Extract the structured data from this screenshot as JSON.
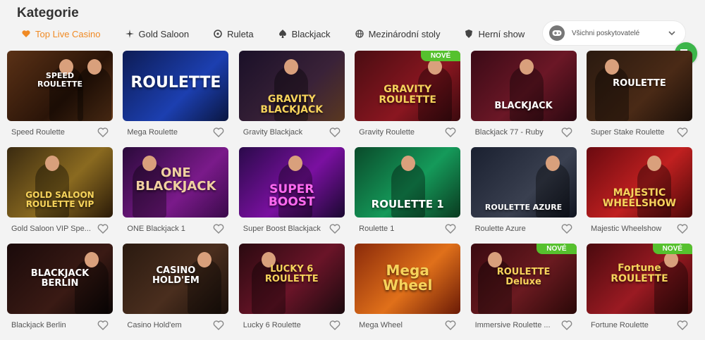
{
  "page": {
    "title": "Kategorie"
  },
  "tabs": [
    {
      "label": "Top Live Casino",
      "icon": "heart-icon",
      "active": true
    },
    {
      "label": "Gold Saloon",
      "icon": "sparkle-icon",
      "active": false
    },
    {
      "label": "Ruleta",
      "icon": "roulette-icon",
      "active": false
    },
    {
      "label": "Blackjack",
      "icon": "spade-icon",
      "active": false
    },
    {
      "label": "Mezinárodní stoly",
      "icon": "globe-icon",
      "active": false
    },
    {
      "label": "Herní show",
      "icon": "shield-icon",
      "active": false
    }
  ],
  "provider_select": {
    "value": "Všichni poskytovatelé",
    "icon": "gamepad-icon"
  },
  "colors": {
    "accent": "#f08a24",
    "badge": "#56c12e",
    "fab": "#3cb54a"
  },
  "games": [
    {
      "name": "Speed Roulette",
      "logo": "SPEED\nROULETTE",
      "badge": ""
    },
    {
      "name": "Mega Roulette",
      "logo": "ROULETTE",
      "badge": ""
    },
    {
      "name": "Gravity Blackjack",
      "logo": "GRAVITY\nBLACKJACK",
      "badge": ""
    },
    {
      "name": "Gravity Roulette",
      "logo": "GRAVITY\nROULETTE",
      "badge": "NOVÉ"
    },
    {
      "name": "Blackjack 77 - Ruby",
      "logo": "BLACKJACK",
      "badge": ""
    },
    {
      "name": "Super Stake Roulette",
      "logo": "ROULETTE",
      "badge": ""
    },
    {
      "name": "Gold Saloon VIP Spe...",
      "logo": "GOLD SALOON\nROULETTE VIP",
      "badge": ""
    },
    {
      "name": "ONE Blackjack 1",
      "logo": "ONE\nBLACKJACK",
      "badge": ""
    },
    {
      "name": "Super Boost Blackjack",
      "logo": "SUPER\nBOOST",
      "badge": ""
    },
    {
      "name": "Roulette 1",
      "logo": "ROULETTE 1",
      "badge": ""
    },
    {
      "name": "Roulette Azure",
      "logo": "ROULETTE AZURE",
      "badge": ""
    },
    {
      "name": "Majestic Wheelshow",
      "logo": "MAJESTIC\nWHEELSHOW",
      "badge": ""
    },
    {
      "name": "Blackjack Berlin",
      "logo": "BLACKJACK\nBERLIN",
      "badge": ""
    },
    {
      "name": "Casino Hold'em",
      "logo": "CASINO\nHOLD'EM",
      "badge": ""
    },
    {
      "name": "Lucky 6 Roulette",
      "logo": "LUCKY 6\nROULETTE",
      "badge": ""
    },
    {
      "name": "Mega Wheel",
      "logo": "Mega\nWheel",
      "badge": ""
    },
    {
      "name": "Immersive Roulette ...",
      "logo": "ROULETTE\nDeluxe",
      "badge": "NOVÉ"
    },
    {
      "name": "Fortune Roulette",
      "logo": "Fortune\nROULETTE",
      "badge": "NOVÉ"
    }
  ]
}
